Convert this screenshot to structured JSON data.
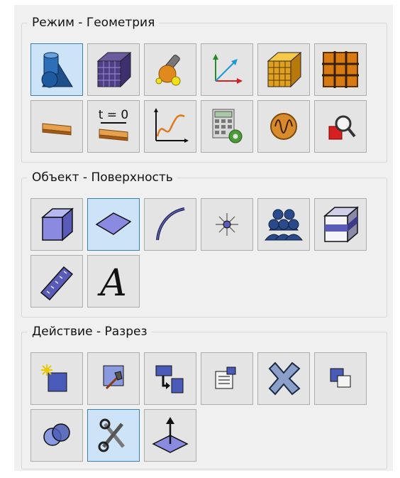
{
  "groups": {
    "mode": {
      "title": "Режим - Геометрия",
      "buttons": [
        {
          "icon": "geometry-shapes-icon",
          "selected": true
        },
        {
          "icon": "mesh-cube-icon",
          "selected": false
        },
        {
          "icon": "physics-tools-icon",
          "selected": false
        },
        {
          "icon": "coordinate-axes-icon",
          "selected": false
        },
        {
          "icon": "orange-mesh-cube-icon",
          "selected": false
        },
        {
          "icon": "grid-window-icon",
          "selected": false
        },
        {
          "icon": "stationary-study-icon",
          "selected": false
        },
        {
          "icon": "time-dependent-study-icon",
          "selected": false
        },
        {
          "icon": "results-plot-icon",
          "selected": false
        },
        {
          "icon": "calculator-settings-icon",
          "selected": false
        },
        {
          "icon": "signal-wave-icon",
          "selected": false
        },
        {
          "icon": "zoom-inspect-icon",
          "selected": false
        }
      ],
      "t0_label": "t = 0"
    },
    "object": {
      "title": "Объект - Поверхность",
      "buttons": [
        {
          "icon": "domain-cube-icon",
          "selected": false
        },
        {
          "icon": "surface-icon",
          "selected": true
        },
        {
          "icon": "curve-edge-icon",
          "selected": false
        },
        {
          "icon": "point-vertex-icon",
          "selected": false
        },
        {
          "icon": "object-group-icon",
          "selected": false
        },
        {
          "icon": "shaded-box-icon",
          "selected": false
        },
        {
          "icon": "ruler-measure-icon",
          "selected": false
        },
        {
          "icon": "text-annotation-icon",
          "selected": false
        }
      ],
      "text_label": "A"
    },
    "action": {
      "title": "Действие - Разрез",
      "buttons": [
        {
          "icon": "new-object-icon",
          "selected": false
        },
        {
          "icon": "edit-build-icon",
          "selected": false
        },
        {
          "icon": "transfer-icon",
          "selected": false
        },
        {
          "icon": "properties-icon",
          "selected": false
        },
        {
          "icon": "delete-cross-icon",
          "selected": false
        },
        {
          "icon": "duplicate-icon",
          "selected": false
        },
        {
          "icon": "intersect-icon",
          "selected": false
        },
        {
          "icon": "cut-scissors-icon",
          "selected": true
        },
        {
          "icon": "cut-plane-icon",
          "selected": false
        }
      ]
    }
  },
  "colors": {
    "button_bg": "#e4e4e4",
    "selected_bg": "#cde3f7",
    "selected_border": "#3c7fb1",
    "panel_bg": "#f0f0f0"
  }
}
